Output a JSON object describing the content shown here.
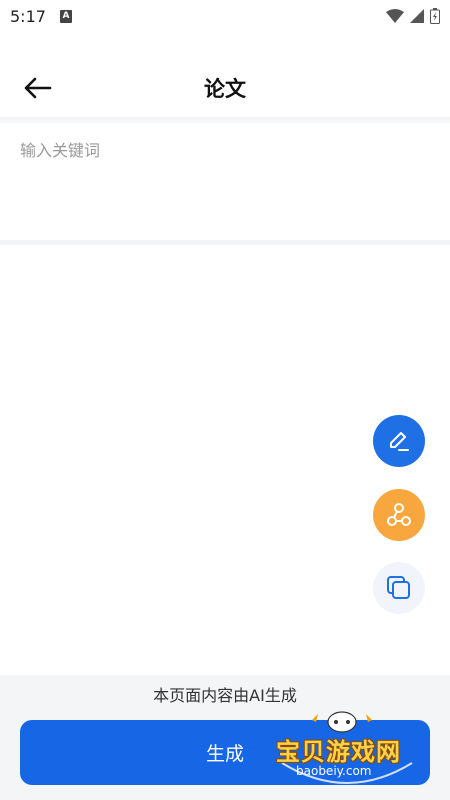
{
  "status_bar": {
    "time": "5:17",
    "notification_icon": "a-icon",
    "icons": [
      "wifi-icon",
      "signal-icon",
      "battery-icon"
    ]
  },
  "header": {
    "back_icon": "arrow-left-icon",
    "title": "论文"
  },
  "keyword_input": {
    "placeholder": "输入关键词",
    "value": ""
  },
  "fabs": [
    {
      "name": "edit-icon",
      "color": "#1f6fe5"
    },
    {
      "name": "share-icon",
      "color": "#f7a73e"
    },
    {
      "name": "copy-icon",
      "color": "#f1f4fa"
    }
  ],
  "footer": {
    "ai_notice": "本页面内容由AI生成",
    "generate_label": "生成"
  },
  "watermark": {
    "title": "宝贝游戏网",
    "url": "baobeiy.com"
  },
  "colors": {
    "primary": "#1766e5",
    "accent_orange": "#f7a73e",
    "panel_bg": "#f4f5f7"
  }
}
